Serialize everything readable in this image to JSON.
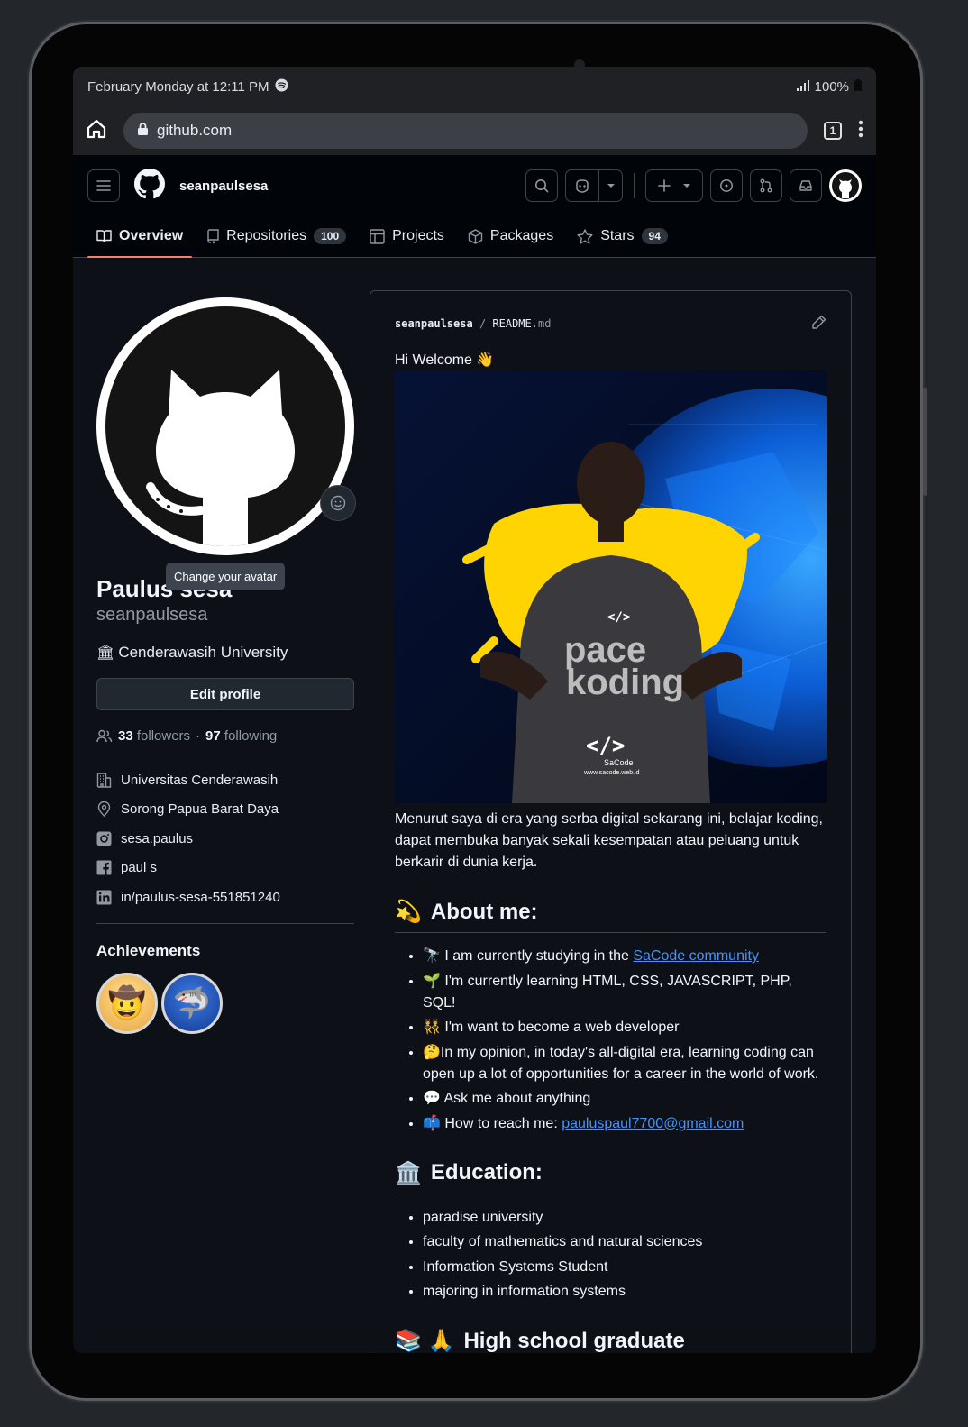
{
  "status": {
    "time": "February Monday at 12:11 PM",
    "battery": "100%"
  },
  "browser": {
    "url": "github.com",
    "tab_count": "1"
  },
  "header": {
    "username": "seanpaulsesa"
  },
  "tabs": [
    {
      "label": "Overview"
    },
    {
      "label": "Repositories",
      "count": "100"
    },
    {
      "label": "Projects"
    },
    {
      "label": "Packages"
    },
    {
      "label": "Stars",
      "count": "94"
    }
  ],
  "profile": {
    "tooltip": "Change your avatar",
    "full_name": "Paulus sesa",
    "username": "seanpaulsesa",
    "bio": "Cenderawasih University",
    "edit_label": "Edit profile",
    "followers": "33",
    "followers_label": "followers",
    "dot": "·",
    "following": "97",
    "following_label": "following",
    "details": [
      {
        "icon": "organization-icon",
        "text": "Universitas Cenderawasih"
      },
      {
        "icon": "location-icon",
        "text": "Sorong Papua Barat Daya"
      },
      {
        "icon": "instagram-icon",
        "text": "sesa.paulus"
      },
      {
        "icon": "facebook-icon",
        "text": "paul s"
      },
      {
        "icon": "linkedin-icon",
        "text": "in/paulus-sesa-551851240"
      }
    ],
    "achievements_title": "Achievements"
  },
  "readme": {
    "repo": "seanpaulsesa",
    "sep": "/",
    "file": "README",
    "ext": ".md",
    "greeting": "Hi Welcome 👋",
    "photo_text": {
      "brand1": "pace",
      "brand2": "koding",
      "logo": "</>",
      "logo_label": "SaCode",
      "url": "www.sacode.web.id"
    },
    "intro": "Menurut saya di era yang serba digital sekarang ini, belajar koding, dapat membuka banyak sekali kesempatan atau peluang untuk berkarir di dunia kerja.",
    "about_title": "About me:",
    "about_emoji": "💫",
    "about": [
      {
        "emoji": "🔭",
        "text": "I am currently studying in the ",
        "link": "SaCode community"
      },
      {
        "emoji": "🌱",
        "text": "I'm currently learning HTML, CSS, JAVASCRIPT, PHP, SQL!"
      },
      {
        "emoji": "👯",
        "text": "I'm want to become a web developer"
      },
      {
        "emoji": "🤔",
        "text": "In my opinion, in today's all-digital era, learning coding can open up a lot of opportunities for a career in the world of work."
      },
      {
        "emoji": "💬",
        "text": "Ask me about anything"
      },
      {
        "emoji": "📫",
        "text": "How to reach me: ",
        "link": "pauluspaul7700@gmail.com"
      }
    ],
    "edu_title": "Education:",
    "edu_emoji": "🏛️",
    "education": [
      "paradise university",
      "faculty of mathematics and natural sciences",
      "Information Systems Student",
      "majoring in information systems"
    ],
    "hs_title": "High school graduate",
    "hs_emoji": "📚 🙏"
  }
}
